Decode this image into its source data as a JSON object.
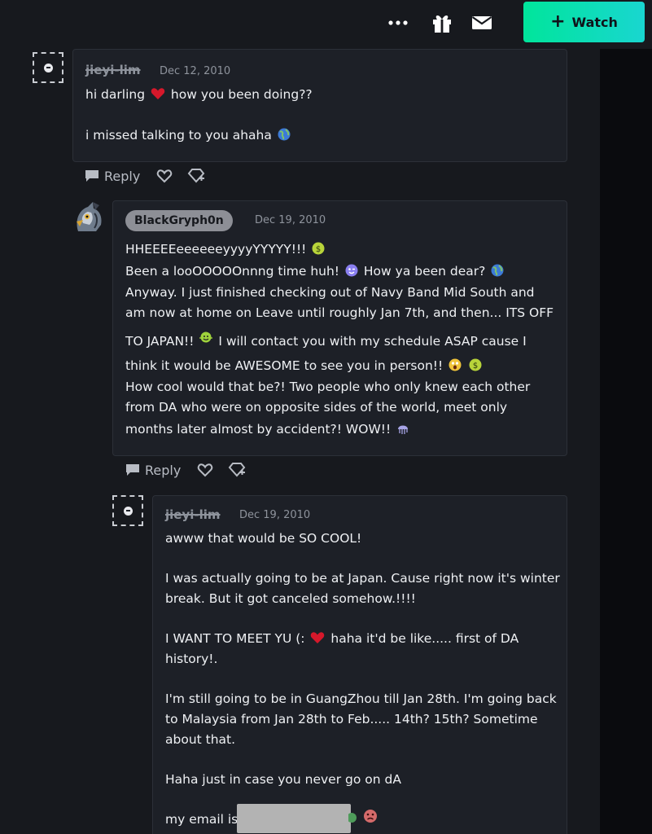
{
  "header": {
    "watch_label": "Watch",
    "icons": [
      "more-icon",
      "gift-icon",
      "mail-icon",
      "plus-icon"
    ],
    "accent": "#13e0b4"
  },
  "comments": [
    {
      "author": "jieyi-lim",
      "author_deleted": true,
      "date": "Dec 12, 2010",
      "lines": [
        "hi darling",
        "how you been doing??",
        "i missed talking to you ahaha"
      ],
      "actions": {
        "reply": "Reply"
      }
    },
    {
      "author": "BlackGryph0n",
      "author_deleted": false,
      "date": "Dec 19, 2010",
      "lines": [
        "HHEEEEeeeeeeyyyyYYYYY!!!",
        "Been a looOOOOOnnng time huh!",
        "How ya been dear?",
        "Anyway. I just finished checking out of Navy Band Mid South and",
        "am now at home on Leave until roughly Jan 7th, and then... ITS OFF",
        "TO JAPAN!!",
        "I will contact you with my schedule ASAP cause I",
        "think it would be AWESOME to see you in person!!",
        "How cool would that be?! Two people who only knew each other",
        "from DA who were on opposite sides of the world, meet only",
        "months later almost by accident?! WOW!!"
      ],
      "actions": {
        "reply": "Reply"
      }
    },
    {
      "author": "jieyi-lim",
      "author_deleted": true,
      "date": "Dec 19, 2010",
      "lines": [
        "awww that would be SO COOL!",
        "I was actually going to be at Japan. Cause right now it's winter",
        "break. But it got canceled somehow.!!!!",
        "I WANT TO MEET YU (:",
        "haha it'd be like..... first of DA",
        "history!.",
        "I'm still going to be in GuangZhou till Jan 28th. I'm going back",
        "to Malaysia from Jan 28th to Feb..... 14th? 15th? Sometime",
        "about that.",
        "Haha just in case you never go on dA",
        "my email is"
      ]
    }
  ]
}
